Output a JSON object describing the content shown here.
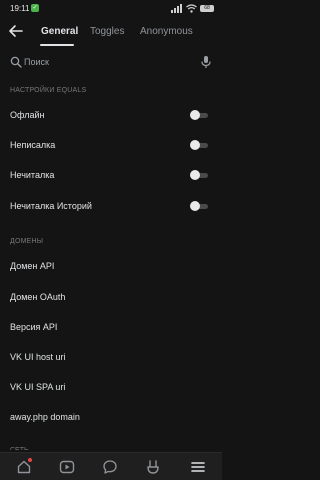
{
  "status_bar": {
    "time": "19:11",
    "battery": "68"
  },
  "header": {
    "tabs": [
      {
        "label": "General",
        "active": true
      },
      {
        "label": "Toggles",
        "active": false
      },
      {
        "label": "Anonymous",
        "active": false
      }
    ]
  },
  "search": {
    "placeholder": "Поиск",
    "value": ""
  },
  "sections": [
    {
      "title": "НАСТРОЙКИ EQUALS",
      "items": [
        {
          "label": "Офлайн",
          "toggle": false
        },
        {
          "label": "Неписалка",
          "toggle": false
        },
        {
          "label": "Нечиталка",
          "toggle": false
        },
        {
          "label": "Нечиталка Историй",
          "toggle": false
        }
      ]
    },
    {
      "title": "ДОМЕНЫ",
      "items": [
        {
          "label": "Домен API"
        },
        {
          "label": "Домен OAuth"
        },
        {
          "label": "Версия API"
        },
        {
          "label": "VK UI host uri"
        },
        {
          "label": "VK UI SPA uri"
        },
        {
          "label": "away.php domain"
        }
      ]
    },
    {
      "title": "СЕТЬ"
    }
  ],
  "bottom_nav": {
    "items": [
      {
        "icon": "home-icon"
      },
      {
        "icon": "video-icon"
      },
      {
        "icon": "messages-icon"
      },
      {
        "icon": "clips-icon"
      },
      {
        "icon": "menu-icon"
      }
    ]
  },
  "colors": {
    "background": "#141414",
    "text": "#e1e3e6",
    "section": "#76787a",
    "accent_status": "#4bb34b"
  }
}
